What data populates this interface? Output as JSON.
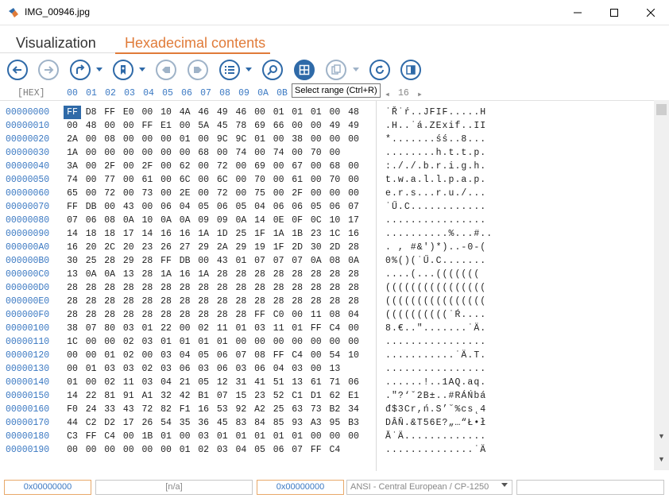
{
  "window": {
    "title": "IMG_00946.jpg"
  },
  "tabs": [
    {
      "label": "Visualization"
    },
    {
      "label": "Hexadecimal contents"
    }
  ],
  "toolbar": {
    "tooltip": "Select range (Ctrl+R)",
    "buttons": [
      "back-icon",
      "forward-icon",
      "go-to-icon",
      "bookmark-icon",
      "prev-bookmark-icon",
      "next-bookmark-icon",
      "list-icon",
      "search-icon",
      "select-range-icon",
      "copy-icon",
      "refresh-icon",
      "panel-icon"
    ]
  },
  "header": {
    "label": "[HEX]",
    "columns": [
      "00",
      "01",
      "02",
      "03",
      "04",
      "05",
      "06",
      "07",
      "08",
      "09",
      "0A",
      "0B"
    ],
    "page_next": "16"
  },
  "rows": [
    {
      "offset": "00000000",
      "hex": [
        "FF",
        "D8",
        "FF",
        "E0",
        "00",
        "10",
        "4A",
        "46",
        "49",
        "46",
        "00",
        "01",
        "01",
        "01",
        "00",
        "48"
      ],
      "text": "˙Ř˙ŕ..JFIF.....H"
    },
    {
      "offset": "00000010",
      "hex": [
        "00",
        "48",
        "00",
        "00",
        "FF",
        "E1",
        "00",
        "5A",
        "45",
        "78",
        "69",
        "66",
        "00",
        "00",
        "49",
        "49"
      ],
      "text": ".H..˙á.ZExif..II"
    },
    {
      "offset": "00000020",
      "hex": [
        "2A",
        "00",
        "08",
        "00",
        "00",
        "00",
        "01",
        "00",
        "9C",
        "9C",
        "01",
        "00",
        "38",
        "00",
        "00",
        "00"
      ],
      "text": "*.......śś..8..."
    },
    {
      "offset": "00000030",
      "hex": [
        "1A",
        "00",
        "00",
        "00",
        "00",
        "00",
        "00",
        "68",
        "00",
        "74",
        "00",
        "74",
        "00",
        "70",
        "00"
      ],
      "text": "........h.t.t.p."
    },
    {
      "offset": "00000040",
      "hex": [
        "3A",
        "00",
        "2F",
        "00",
        "2F",
        "00",
        "62",
        "00",
        "72",
        "00",
        "69",
        "00",
        "67",
        "00",
        "68",
        "00"
      ],
      "text": ":././.b.r.i.g.h."
    },
    {
      "offset": "00000050",
      "hex": [
        "74",
        "00",
        "77",
        "00",
        "61",
        "00",
        "6C",
        "00",
        "6C",
        "00",
        "70",
        "00",
        "61",
        "00",
        "70",
        "00"
      ],
      "text": "t.w.a.l.l.p.a.p."
    },
    {
      "offset": "00000060",
      "hex": [
        "65",
        "00",
        "72",
        "00",
        "73",
        "00",
        "2E",
        "00",
        "72",
        "00",
        "75",
        "00",
        "2F",
        "00",
        "00",
        "00"
      ],
      "text": "e.r.s...r.u./..."
    },
    {
      "offset": "00000070",
      "hex": [
        "FF",
        "DB",
        "00",
        "43",
        "00",
        "06",
        "04",
        "05",
        "06",
        "05",
        "04",
        "06",
        "06",
        "05",
        "06",
        "07"
      ],
      "text": "˙Ű.C............"
    },
    {
      "offset": "00000080",
      "hex": [
        "07",
        "06",
        "08",
        "0A",
        "10",
        "0A",
        "0A",
        "09",
        "09",
        "0A",
        "14",
        "0E",
        "0F",
        "0C",
        "10",
        "17"
      ],
      "text": "................"
    },
    {
      "offset": "00000090",
      "hex": [
        "14",
        "18",
        "18",
        "17",
        "14",
        "16",
        "16",
        "1A",
        "1D",
        "25",
        "1F",
        "1A",
        "1B",
        "23",
        "1C",
        "16"
      ],
      "text": "..........%...#.."
    },
    {
      "offset": "000000A0",
      "hex": [
        "16",
        "20",
        "2C",
        "20",
        "23",
        "26",
        "27",
        "29",
        "2A",
        "29",
        "19",
        "1F",
        "2D",
        "30",
        "2D",
        "28"
      ],
      "text": ". , #&')*)..-0-("
    },
    {
      "offset": "000000B0",
      "hex": [
        "30",
        "25",
        "28",
        "29",
        "28",
        "FF",
        "DB",
        "00",
        "43",
        "01",
        "07",
        "07",
        "07",
        "0A",
        "08",
        "0A"
      ],
      "text": "0%()(˙Ű.C......."
    },
    {
      "offset": "000000C0",
      "hex": [
        "13",
        "0A",
        "0A",
        "13",
        "28",
        "1A",
        "16",
        "1A",
        "28",
        "28",
        "28",
        "28",
        "28",
        "28",
        "28",
        "28"
      ],
      "text": "....(...((((((("
    },
    {
      "offset": "000000D0",
      "hex": [
        "28",
        "28",
        "28",
        "28",
        "28",
        "28",
        "28",
        "28",
        "28",
        "28",
        "28",
        "28",
        "28",
        "28",
        "28",
        "28"
      ],
      "text": "(((((((((((((((("
    },
    {
      "offset": "000000E0",
      "hex": [
        "28",
        "28",
        "28",
        "28",
        "28",
        "28",
        "28",
        "28",
        "28",
        "28",
        "28",
        "28",
        "28",
        "28",
        "28",
        "28"
      ],
      "text": "(((((((((((((((("
    },
    {
      "offset": "000000F0",
      "hex": [
        "28",
        "28",
        "28",
        "28",
        "28",
        "28",
        "28",
        "28",
        "28",
        "28",
        "FF",
        "C0",
        "00",
        "11",
        "08",
        "04"
      ],
      "text": "((((((((((˙Ŕ...."
    },
    {
      "offset": "00000100",
      "hex": [
        "38",
        "07",
        "80",
        "03",
        "01",
        "22",
        "00",
        "02",
        "11",
        "01",
        "03",
        "11",
        "01",
        "FF",
        "C4",
        "00"
      ],
      "text": "8.€..\".......˙Ä."
    },
    {
      "offset": "00000110",
      "hex": [
        "1C",
        "00",
        "00",
        "02",
        "03",
        "01",
        "01",
        "01",
        "01",
        "00",
        "00",
        "00",
        "00",
        "00",
        "00",
        "00"
      ],
      "text": "................"
    },
    {
      "offset": "00000120",
      "hex": [
        "00",
        "00",
        "01",
        "02",
        "00",
        "03",
        "04",
        "05",
        "06",
        "07",
        "08",
        "FF",
        "C4",
        "00",
        "54",
        "10"
      ],
      "text": "...........˙Ä.T."
    },
    {
      "offset": "00000130",
      "hex": [
        "00",
        "01",
        "03",
        "03",
        "02",
        "03",
        "06",
        "03",
        "06",
        "03",
        "06",
        "04",
        "03",
        "00",
        "13"
      ],
      "text": "................"
    },
    {
      "offset": "00000140",
      "hex": [
        "01",
        "00",
        "02",
        "11",
        "03",
        "04",
        "21",
        "05",
        "12",
        "31",
        "41",
        "51",
        "13",
        "61",
        "71",
        "06"
      ],
      "text": "......!..1AQ.aq."
    },
    {
      "offset": "00000150",
      "hex": [
        "14",
        "22",
        "81",
        "91",
        "A1",
        "32",
        "42",
        "B1",
        "07",
        "15",
        "23",
        "52",
        "C1",
        "D1",
        "62",
        "E1"
      ],
      "text": ".\"?‘ˇ2B±..#RÁŃbá"
    },
    {
      "offset": "00000160",
      "hex": [
        "F0",
        "24",
        "33",
        "43",
        "72",
        "82",
        "F1",
        "16",
        "53",
        "92",
        "A2",
        "25",
        "63",
        "73",
        "B2",
        "34"
      ],
      "text": "đ$3Cr,ń.S’˘%cs˛4"
    },
    {
      "offset": "00000170",
      "hex": [
        "44",
        "C2",
        "D2",
        "17",
        "26",
        "54",
        "35",
        "36",
        "45",
        "83",
        "84",
        "85",
        "93",
        "A3",
        "95",
        "B3"
      ],
      "text": "DÂŇ.&T56E?„…“Ł•ł"
    },
    {
      "offset": "00000180",
      "hex": [
        "C3",
        "FF",
        "C4",
        "00",
        "1B",
        "01",
        "00",
        "03",
        "01",
        "01",
        "01",
        "01",
        "01",
        "00",
        "00",
        "00"
      ],
      "text": "Ă˙Ä............."
    },
    {
      "offset": "00000190",
      "hex": [
        "00",
        "00",
        "00",
        "00",
        "00",
        "00",
        "01",
        "02",
        "03",
        "04",
        "05",
        "06",
        "07",
        "FF",
        "C4"
      ],
      "text": "..............˙Ä"
    }
  ],
  "status": {
    "position": "0x00000000",
    "selection": "[n/a]",
    "offset": "0x00000000",
    "encoding": "ANSI - Central European / CP-1250",
    "extra": ""
  }
}
